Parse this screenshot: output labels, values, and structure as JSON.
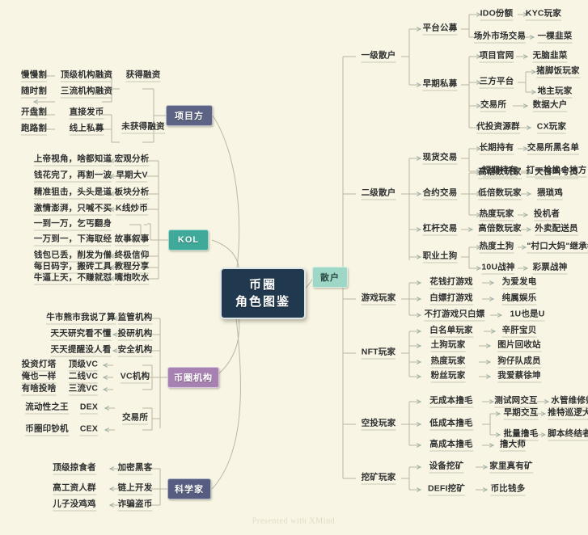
{
  "meta": {
    "central_title_line1": "币圈",
    "central_title_line2": "角色图鉴",
    "watermark": "Presented with XMind",
    "background_color": "#f8f5e4",
    "central_color": "#20394e"
  },
  "branches": {
    "project": {
      "label": "项目方",
      "color": "#5c6384",
      "groups": [
        {
          "label": "获得融资",
          "children": [
            {
              "label": "顶级机构融资",
              "result": "慢慢割"
            },
            {
              "label": "三流机构融资",
              "result": "随时割"
            }
          ]
        },
        {
          "label": "未获得融资",
          "children": [
            {
              "label": "直接发币",
              "result": "开盘割"
            },
            {
              "label": "线上私募",
              "result": "跑路割"
            }
          ]
        }
      ]
    },
    "kol": {
      "label": "KOL",
      "color": "#3fa99a",
      "items": [
        {
          "label": "宏观分析",
          "result": "上帝视角，啥都知道"
        },
        {
          "label": "早期大V",
          "result": "钱花完了，再割一波"
        },
        {
          "label": "板块分析",
          "result": "精准狙击，头头是道"
        },
        {
          "label": "K线炒币",
          "result": "激情澎湃，只喊不买"
        },
        {
          "label": "故事叙事",
          "result": "一到一万，乞丐翻身",
          "result2": "一万到一，下海取经"
        },
        {
          "label": "终极信仰",
          "result": "钱包已丢，削发为僧"
        },
        {
          "label": "教程分享",
          "result": "每日码字，搬砖工具"
        },
        {
          "label": "嘴炮吹水",
          "result": "牛逼上天，不赚就怼"
        }
      ]
    },
    "institution": {
      "label": "币圈机构",
      "color": "#a881b3",
      "groups": [
        {
          "label": "",
          "children": [
            {
              "label": "监管机构",
              "result": "牛市熊市我说了算"
            },
            {
              "label": "投研机构",
              "result": "天天研究看不懂"
            },
            {
              "label": "安全机构",
              "result": "天天提醒没人看"
            }
          ]
        },
        {
          "label": "VC机构",
          "children": [
            {
              "label": "顶级VC",
              "result": "投资灯塔"
            },
            {
              "label": "二线VC",
              "result": "俺也一样"
            },
            {
              "label": "三流VC",
              "result": "有啥投啥"
            }
          ]
        },
        {
          "label": "交易所",
          "children": [
            {
              "label": "DEX",
              "result": "流动性之王"
            },
            {
              "label": "CEX",
              "result": "币圈印钞机"
            }
          ]
        }
      ]
    },
    "scientist": {
      "label": "科学家",
      "color": "#565d80",
      "items": [
        {
          "label": "加密黑客",
          "result": "顶级掠食者"
        },
        {
          "label": "链上开发",
          "result": "高工资人群"
        },
        {
          "label": "诈骗盗币",
          "result": "儿子没鸡鸡"
        }
      ]
    },
    "retail": {
      "label": "散户",
      "color": "#9fd7c6",
      "groups": [
        {
          "label": "一级散户",
          "children": [
            {
              "label": "平台公募",
              "leaves": [
                {
                  "label": "IDO份额",
                  "result": "KYC玩家"
                },
                {
                  "label": "场外市场交易",
                  "result": "一棵韭菜"
                }
              ]
            },
            {
              "label": "早期私募",
              "leaves": [
                {
                  "label": "项目官网",
                  "result": "无脑韭菜"
                },
                {
                  "label": "三方平台",
                  "result": "猪脚饭玩家",
                  "result2": "地主玩家"
                },
                {
                  "label": "交易所",
                  "result": "数据大户"
                },
                {
                  "label": "代投资源群",
                  "result": "CX玩家"
                }
              ]
            }
          ]
        },
        {
          "label": "二级散户",
          "children": [
            {
              "label": "现货交易",
              "leaves": [
                {
                  "label": "长期持有",
                  "result": "交易所黑名单"
                },
                {
                  "label": "短期持有",
                  "result": "打一枪换个地方"
                }
              ]
            },
            {
              "label": "合约交易",
              "leaves": [
                {
                  "label": "高倍数玩家",
                  "result": "天台叫号员"
                },
                {
                  "label": "低倍数玩家",
                  "result": "猥琐鸡"
                },
                {
                  "label": "热度玩家",
                  "result": "投机者"
                }
              ]
            },
            {
              "label": "杠杆交易",
              "leaves": [
                {
                  "label": "高倍数玩家",
                  "result": "外卖配送员"
                }
              ]
            },
            {
              "label": "职业土狗",
              "leaves": [
                {
                  "label": "热度土狗",
                  "result": "\"村口大妈\"继承者"
                },
                {
                  "label": "10U战神",
                  "result": "彩票战神"
                }
              ]
            }
          ]
        },
        {
          "label": "游戏玩家",
          "leaves": [
            {
              "label": "花钱打游戏",
              "result": "为爱发电"
            },
            {
              "label": "白嫖打游戏",
              "result": "纯属娱乐"
            },
            {
              "label": "不打游戏只白嫖",
              "result": "1U也是U"
            }
          ]
        },
        {
          "label": "NFT玩家",
          "leaves": [
            {
              "label": "白名单玩家",
              "result": "辛肝宝贝"
            },
            {
              "label": "土狗玩家",
              "result": "图片回收站"
            },
            {
              "label": "热度玩家",
              "result": "狗仔队成员"
            },
            {
              "label": "粉丝玩家",
              "result": "我爱蔡徐坤"
            }
          ]
        },
        {
          "label": "空投玩家",
          "leaves": [
            {
              "label": "无成本撸毛",
              "result": "测试网交互",
              "result2": "水管维修师"
            },
            {
              "label": "低成本撸毛",
              "result": "早期交互",
              "result2": "推特巡逻犬",
              "result3": "批量撸毛",
              "result4": "脚本终结者"
            },
            {
              "label": "高成本撸毛",
              "result": "撸大师"
            }
          ]
        },
        {
          "label": "挖矿玩家",
          "leaves": [
            {
              "label": "设备挖矿",
              "result": "家里真有矿"
            },
            {
              "label": "DEFI挖矿",
              "result": "币比钱多"
            }
          ]
        }
      ]
    }
  }
}
